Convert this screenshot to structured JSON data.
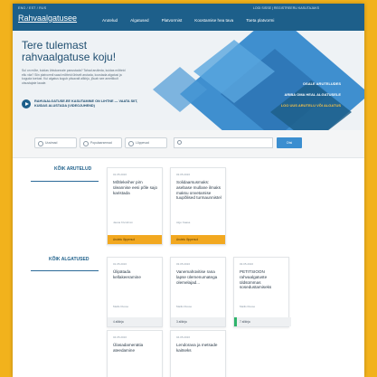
{
  "nav": {
    "lang": "ENG / EST / RUS",
    "account": "LOGI SISSE | REGISTREERU KASUTAJAKS",
    "brand": "Rahvaalgatusee",
    "menu": [
      "Arutelud",
      "Algatused",
      "Platvormist",
      "Koostamise hea tava",
      "Toeta platvormi"
    ]
  },
  "hero": {
    "title": "Tere tulemast rahvaalgatuse koju!",
    "intro": "Sul on mõte, kuidas ühiskonnale panustada? Tahad arutleda, kuidas mõtteid ellu viia? Siin platvormil saad mõtteid ühiselt arutada, koostada algatusi ja koguda toetust. Kui algatus kogub piisavalt allkirju, jõuab see ametlikult otsustajate lauale.",
    "video_text": "RAHVAALGATUSE.EE KASUTAMINE ON LIHTNE — VAATA SIIT, KUIDAS ALUSTADA (VIDEOJUHEND)",
    "cta1": "OSALE ARUTELUDES",
    "cta2": "ARIBA OMA HEAL ALGATUSELE",
    "cta3": "LOO UUS ARUTELU VÕI ALGATUS"
  },
  "filters": {
    "options": [
      "Uusimad",
      "Populaarsemad",
      "Lõppevad"
    ],
    "search_placeholder": "Otsi algatust",
    "search_button": "Otsi"
  },
  "discussions": {
    "heading": "KÕIK ARUTELUD",
    "cards": [
      {
        "date": "01.05.2016",
        "title": "Mõtlekeiher pirn üleannise eesi põle sajo karistada",
        "author": "Jaana Kivinõmm",
        "status": "Arutelu lõppenud"
      },
      {
        "date": "03.05.2016",
        "title": "Solidaarsusmaks: asebase mullane ilmaks maksu onvetamise tuupõlised turmaunnistel",
        "author": "Algo Kaasa",
        "status": "Arutelu lõppenud"
      }
    ]
  },
  "initiatives": {
    "heading": "KÕIK ALGATUSED",
    "cards": [
      {
        "date": "01.05.2016",
        "title": "Ülipätada kellakeeramine",
        "author": "Mailis Ruuse",
        "status": "4 allkirja"
      },
      {
        "date": "03.05.2016",
        "title": "Vanemahüvitise rana lapse ülemenumatega olemelajad...",
        "author": "Mailis Ruuse",
        "status": "3 allkirja"
      },
      {
        "date": "03.05.2016",
        "title": "PETITSIOON rahvaalgatuste üldsümmas sosedustamiseks",
        "author": "Mailis Ruuse",
        "status": "7 allkirja"
      },
      {
        "date": "04.05.2016",
        "title": "Ülasadamenätia ateedamine",
        "author": "",
        "status": ""
      },
      {
        "date": "04.05.2016",
        "title": "Lendorava ja metsade kaitseks",
        "author": "",
        "status": ""
      }
    ]
  },
  "colors": {
    "brand": "#1d5f8a",
    "accent": "#f2a820",
    "success": "#2fb36b",
    "background": "#f2b21c"
  }
}
